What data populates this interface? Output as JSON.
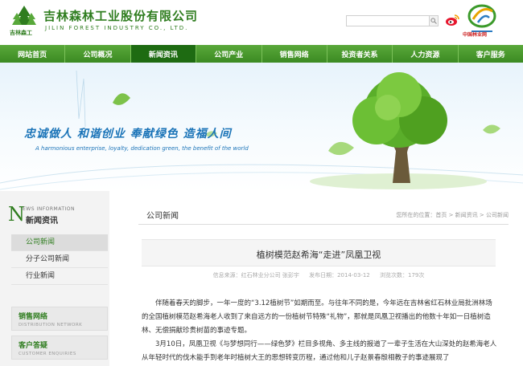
{
  "header": {
    "logo_sub": "吉林森工",
    "company_cn": "吉林森林工业股份有限公司",
    "company_en": "JILIN FOREST INDUSTRY CO., LTD.",
    "search": {
      "placeholder": "",
      "value": ""
    },
    "forestnet_label": "中国林业网",
    "icons": [
      "tree-logo-icon",
      "search-icon",
      "weibo-icon",
      "forestnet-logo-icon"
    ]
  },
  "nav": {
    "items": [
      "网站首页",
      "公司概况",
      "新闻资讯",
      "公司产业",
      "销售网络",
      "投资者关系",
      "人力资源",
      "客户服务"
    ],
    "active": "新闻资讯"
  },
  "banner": {
    "slogan": "忠诚做人  和谐创业  奉献绿色  造福人间",
    "slogan_en": "A harmonious enterprise, loyalty, dedication green, the benefit of the world"
  },
  "sidebar": {
    "title_letter": "N",
    "title_en": "EWS INFORMATION",
    "title_cn": "新闻资讯",
    "menu": [
      "公司新闻",
      "分子公司新闻",
      "行业新闻"
    ],
    "active": "公司新闻",
    "boxes": [
      {
        "cn": "销售网络",
        "en": "DISTRIBUTION NETWORK"
      },
      {
        "cn": "客户答疑",
        "en": "CUSTOMER ENQUIRIES"
      }
    ]
  },
  "main": {
    "section_title": "公司新闻",
    "breadcrumb": "您所在的位置：首页 > 新闻资讯 > 公司新闻",
    "article_title": "植树模范赵希海“走进”凤凰卫视",
    "meta": {
      "source": "信息来源：红石林业分公司 张彭宇",
      "date": "发布日期：2014-03-12",
      "views": "浏览次数：179次"
    },
    "paragraphs": [
      "伴随着春天的脚步，一年一度的“3.12植树节”如期而至。与往年不同的是，今年远在吉林省红石林业局批洲林场的全国植树模范赵希海老人收到了来自远方的一份植树节特殊“礼物”，那就是凤凰卫视播出的他数十年如一日植树造林、无偿捐献珍贵树苗的事迹专题。",
      "3月10日，凤凰卫视《与梦想同行——绿色梦》栏目多视角、多主线的报道了一辈子生活在大山深处的赵希海老人从年轻时代的伐木能手到老年时植树大王的思想转变历程，通过他和儿子赵景春殷相教子的事迹展现了"
    ]
  },
  "colors": {
    "brand_green": "#2f7d1f",
    "nav_green": "#3b8a22",
    "nav_active": "#1e6b12",
    "slogan_blue": "#1b74b8"
  }
}
